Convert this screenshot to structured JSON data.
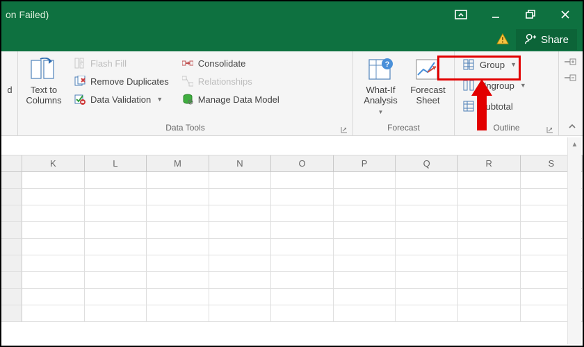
{
  "titlebar": {
    "fragment": "on Failed)"
  },
  "share": {
    "label": "Share"
  },
  "ribbon": {
    "text_to_columns": "Text to\nColumns",
    "flash_fill": "Flash Fill",
    "remove_dup": "Remove Duplicates",
    "data_validation": "Data Validation",
    "consolidate": "Consolidate",
    "relationships": "Relationships",
    "manage_model": "Manage Data Model",
    "whatif": "What-If\nAnalysis",
    "forecast_sheet": "Forecast\nSheet",
    "group": "Group",
    "ungroup": "Ungroup",
    "subtotal": "Subtotal",
    "group_labels": {
      "data_tools": "Data Tools",
      "forecast": "Forecast",
      "outline": "Outline"
    }
  },
  "columns": [
    "K",
    "L",
    "M",
    "N",
    "O",
    "P",
    "Q",
    "R",
    "S"
  ],
  "grid_rows": 9
}
